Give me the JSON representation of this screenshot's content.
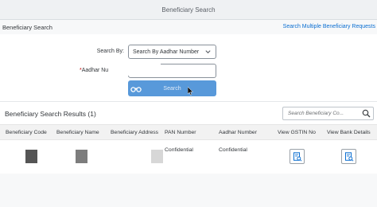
{
  "shell": {
    "title": "Beneficiary Search"
  },
  "toolbar": {
    "page_title": "Beneficiary Search",
    "multi_search_link": "Search Multiple Beneficiary Requests"
  },
  "form": {
    "search_by_label": "Search By:",
    "search_by_value": "Search By Aadhar Number",
    "aadhar_label_required": "*",
    "aadhar_label": "Aadhar Nu",
    "aadhar_value": "",
    "search_button": "Search"
  },
  "results": {
    "title": "Beneficiary Search Results (1)",
    "search_placeholder": "Search Beneficiary Co...",
    "columns": [
      "Beneficiary Code",
      "Beneficiary Name",
      "Beneficiary Address",
      "PAN Number",
      "Aadhar Number",
      "View GSTIN No",
      "View Bank Details"
    ],
    "rows": [
      {
        "pan": "Confidential",
        "aadhar": "Confidential"
      }
    ]
  },
  "colors": {
    "accent": "#0a6ed1",
    "button": "#5899da",
    "redaction_dark": "#555555",
    "redaction_mid": "#7d7d7d",
    "redaction_light": "#d7d7d7"
  },
  "icons": [
    "chevron-down-icon",
    "binoculars-icon",
    "magnifier-icon",
    "document-view-icon",
    "mouse-cursor-icon"
  ]
}
